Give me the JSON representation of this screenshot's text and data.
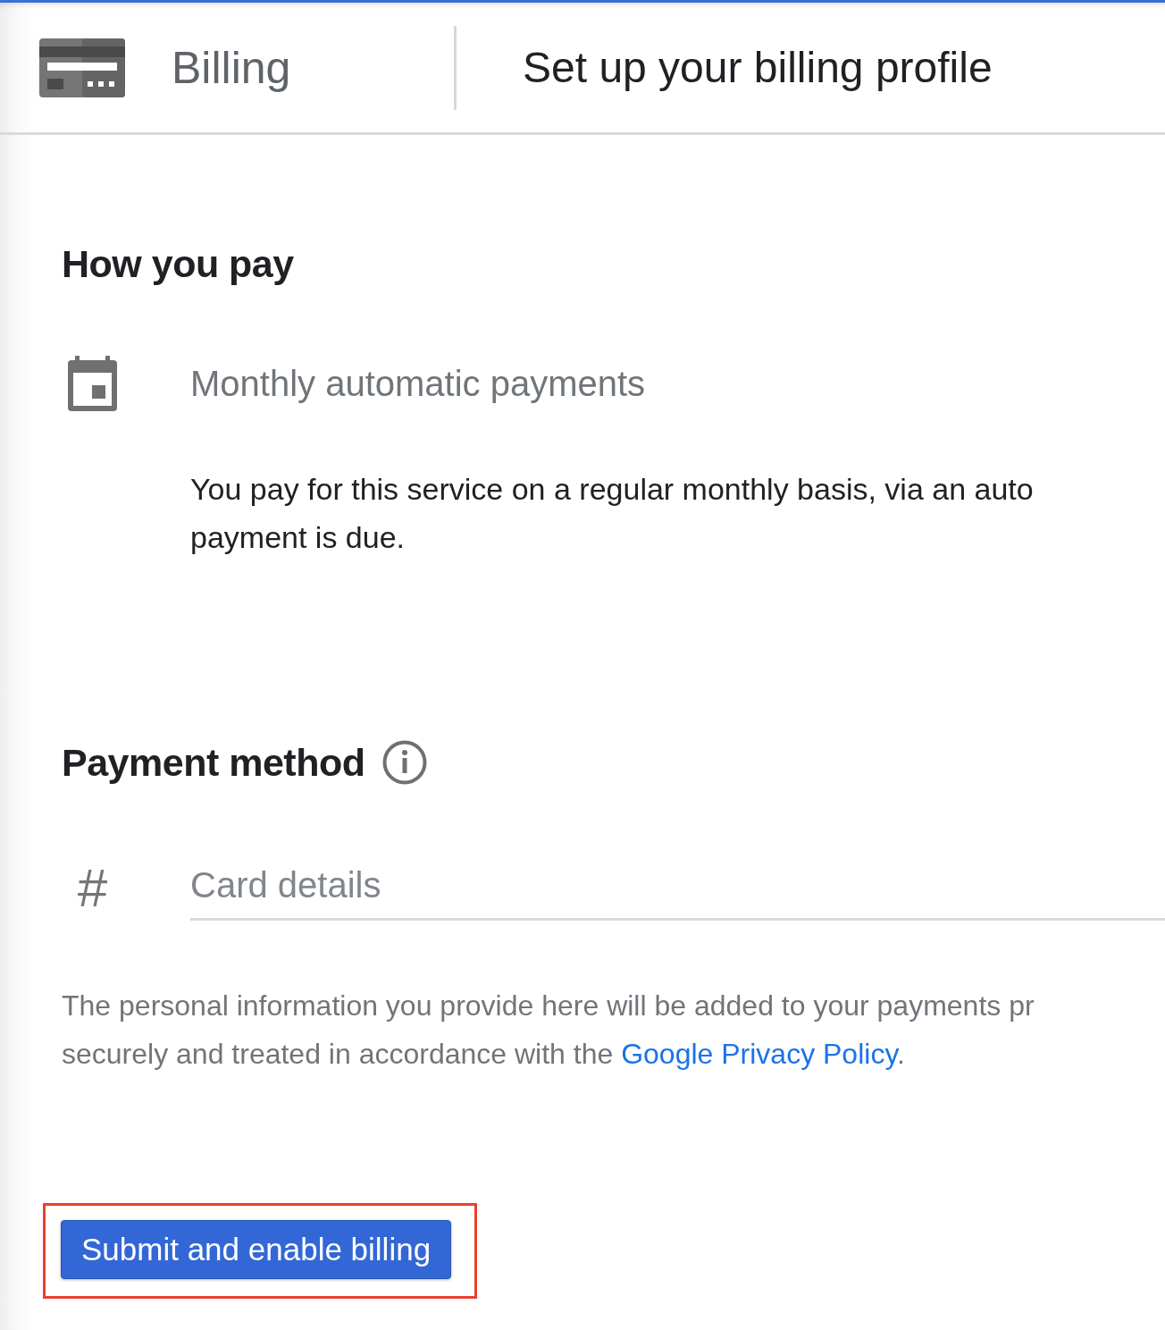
{
  "header": {
    "section": "Billing",
    "title": "Set up your billing profile"
  },
  "how_you_pay": {
    "heading": "How you pay",
    "option": "Monthly automatic payments",
    "description_lines": [
      "You pay for this service on a regular monthly basis, via an auto",
      "payment is due."
    ]
  },
  "payment_method": {
    "heading": "Payment method",
    "card_icon": "#",
    "card_field": {
      "placeholder": "Card details"
    },
    "notice_lines": [
      "The personal information you provide here will be added to your payments pr",
      "securely and treated in accordance with the "
    ],
    "link": "Google Privacy Policy",
    "link_after": "."
  },
  "submit_button": {
    "label": "Submit and enable billing",
    "highlighted": true
  }
}
